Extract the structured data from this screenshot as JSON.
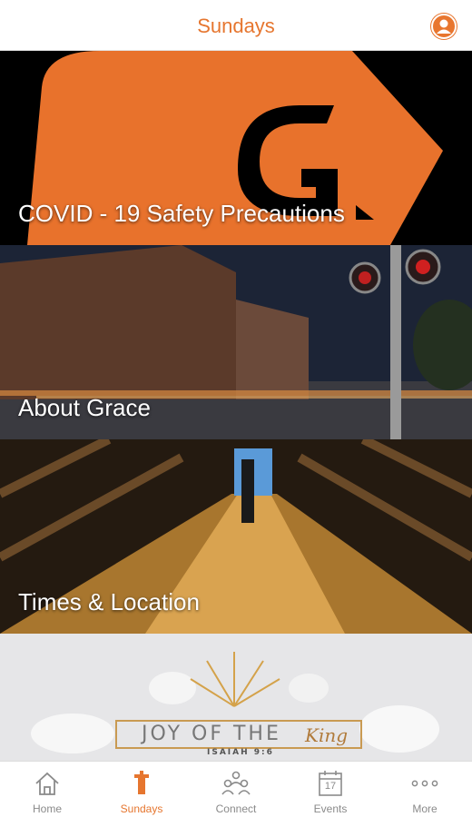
{
  "header": {
    "title": "Sundays",
    "profile_icon": "user-icon"
  },
  "tiles": [
    {
      "label": "COVID - 19 Safety Precautions",
      "image": "grace-logo-orange"
    },
    {
      "label": "About Grace",
      "image": "night-street-photo"
    },
    {
      "label": "Times & Location",
      "image": "covered-bridge-photo"
    },
    {
      "label": "",
      "image": "joy-of-the-king-graphic",
      "graphic_text": {
        "title": "JOY OF THE",
        "script": "King",
        "reference": "ISAIAH 9:6"
      }
    }
  ],
  "tabbar": {
    "items": [
      {
        "label": "Home",
        "icon": "house-icon",
        "active": false
      },
      {
        "label": "Sundays",
        "icon": "pulpit-icon",
        "active": true
      },
      {
        "label": "Connect",
        "icon": "people-icon",
        "active": false
      },
      {
        "label": "Events",
        "icon": "calendar-icon",
        "active": false,
        "calendar_day": "17"
      },
      {
        "label": "More",
        "icon": "more-dots-icon",
        "active": false
      }
    ]
  },
  "colors": {
    "accent": "#e6762f",
    "tab_inactive": "#8a8a8a"
  }
}
